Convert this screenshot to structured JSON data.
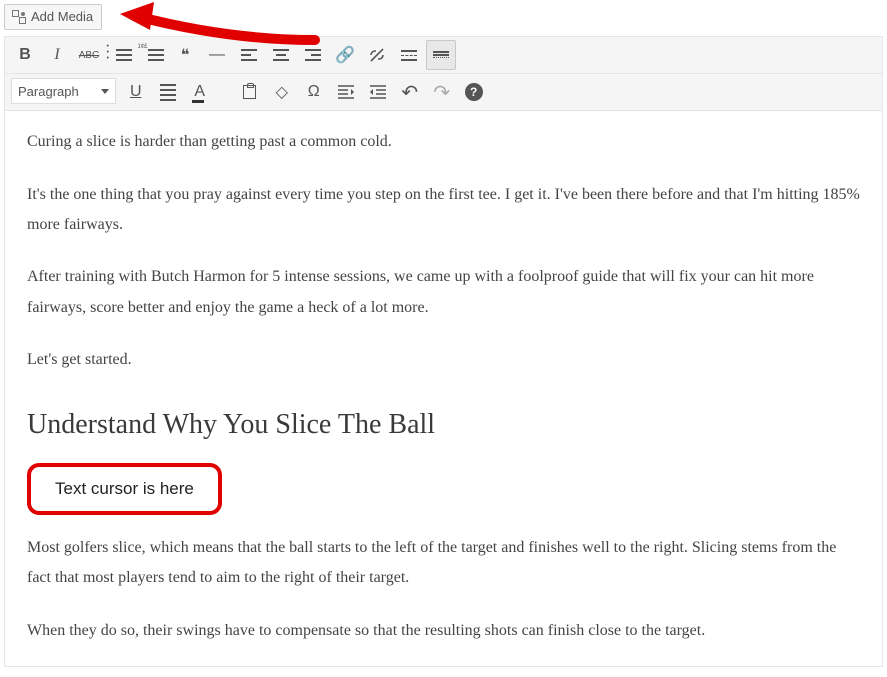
{
  "media_button": {
    "label": "Add Media"
  },
  "toolbar1": {
    "bold": "B",
    "italic": "I",
    "strike": "ABC",
    "quote": "❝",
    "hr": "—",
    "link": "🔗",
    "unlink": "✂",
    "more": "≡"
  },
  "toolbar2": {
    "format_label": "Paragraph",
    "underline": "U",
    "textcolor_letter": "A",
    "clear": "◇",
    "omega": "Ω",
    "undo": "↶",
    "redo": "↷",
    "help": "?"
  },
  "content": {
    "p1": "Curing a slice is harder than getting past a common cold.",
    "p2": "It's the one thing that you pray against every time you step on the first tee. I get it. I've been there before and that I'm hitting 185% more fairways.",
    "p3": "After training with Butch Harmon for 5 intense sessions, we came up with a foolproof guide that will fix your can hit more fairways, score better and enjoy the game a heck of a lot more.",
    "p4": "Let's get started.",
    "h2": "Understand Why You Slice The Ball",
    "cursor_note": "Text cursor is here",
    "p5": "Most golfers slice, which means that the ball starts to the left of the target and finishes well to the right. Slicing stems from the fact that most players tend to aim to the right of their target.",
    "p6": "When they do so, their swings have to compensate so that the resulting shots can finish close to the target."
  }
}
